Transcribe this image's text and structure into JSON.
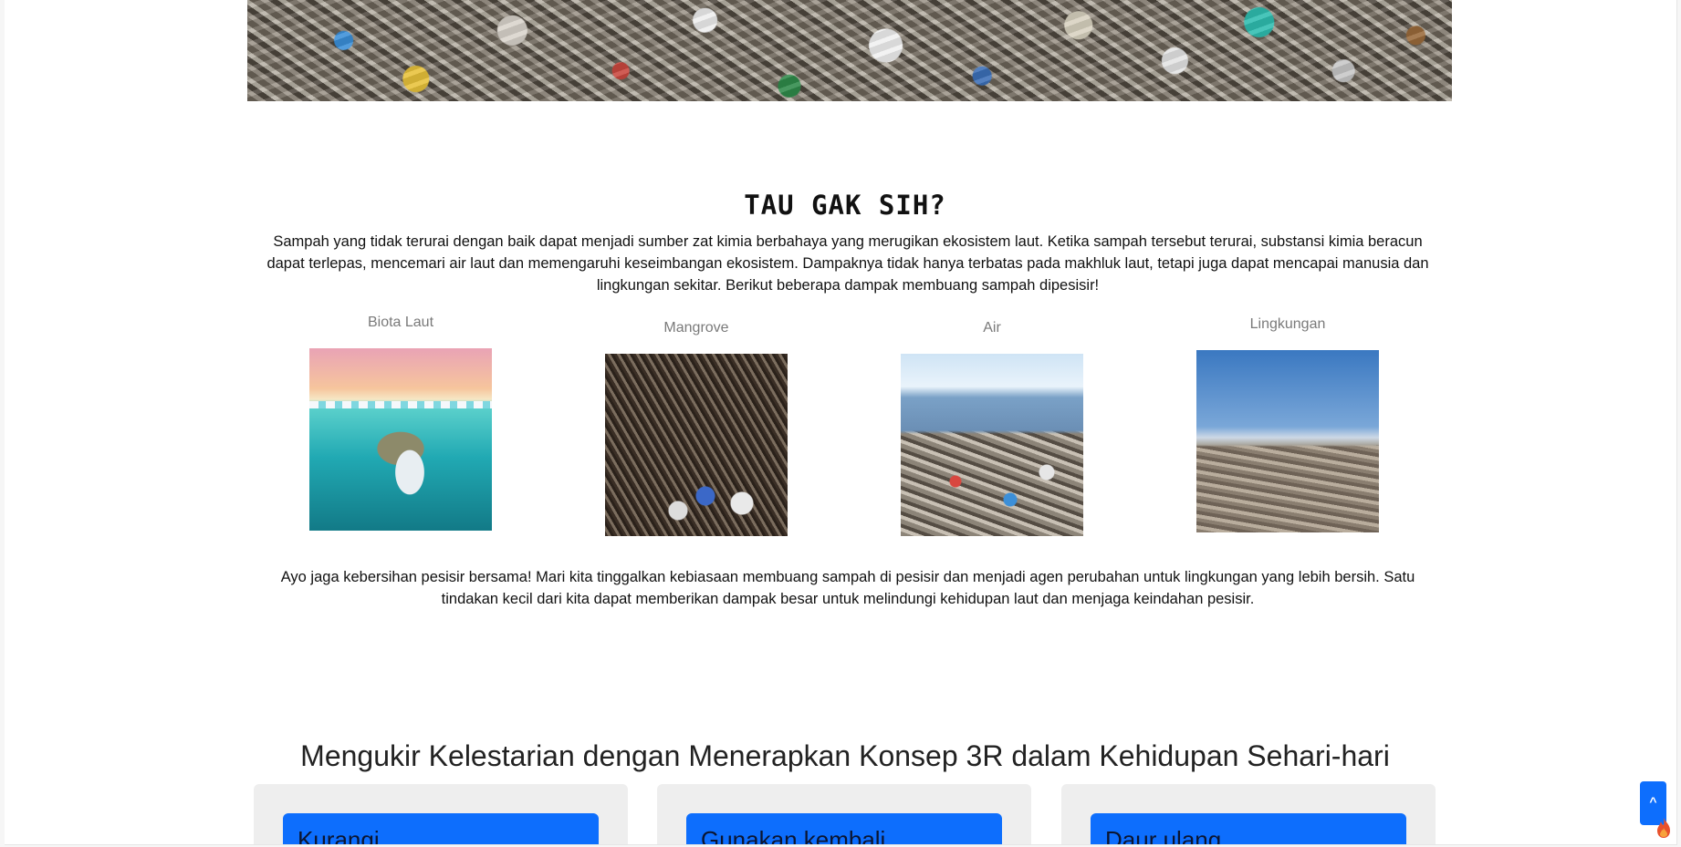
{
  "hero": {
    "image_alt": "Tumpukan sampah di pesisir"
  },
  "fact_section": {
    "title": "TAU GAK SIH?",
    "intro": "Sampah yang tidak terurai dengan baik dapat menjadi sumber zat kimia berbahaya yang merugikan ekosistem laut. Ketika sampah tersebut terurai, substansi kimia beracun dapat terlepas, mencemari air laut dan memengaruhi keseimbangan ekosistem. Dampaknya tidak hanya terbatas pada makhluk laut, tetapi juga dapat mencapai manusia dan lingkungan sekitar. Berikut beberapa dampak membuang sampah dipesisir!",
    "impacts": [
      {
        "label": "Biota Laut"
      },
      {
        "label": "Mangrove"
      },
      {
        "label": "Air"
      },
      {
        "label": "Lingkungan"
      }
    ],
    "outro": "Ayo jaga kebersihan pesisir bersama! Mari kita tinggalkan kebiasaan membuang sampah di pesisir dan menjadi agen perubahan untuk lingkungan yang lebih bersih. Satu tindakan kecil dari kita dapat memberikan dampak besar untuk melindungi kehidupan laut dan menjaga keindahan pesisir."
  },
  "three_r_section": {
    "title": "Mengukir Kelestarian dengan Menerapkan Konsep 3R dalam Kehidupan Sehari-hari",
    "cards": [
      {
        "button": "Kurangi"
      },
      {
        "button": "Gunakan kembali"
      },
      {
        "button": "Daur ulang"
      }
    ]
  },
  "scroll_top": {
    "label": "^"
  },
  "icons": {
    "fire": "fire-icon"
  },
  "colors": {
    "primary": "#0d6efd",
    "card_bg": "#eeeeee",
    "muted_label": "#7a7a7a"
  }
}
